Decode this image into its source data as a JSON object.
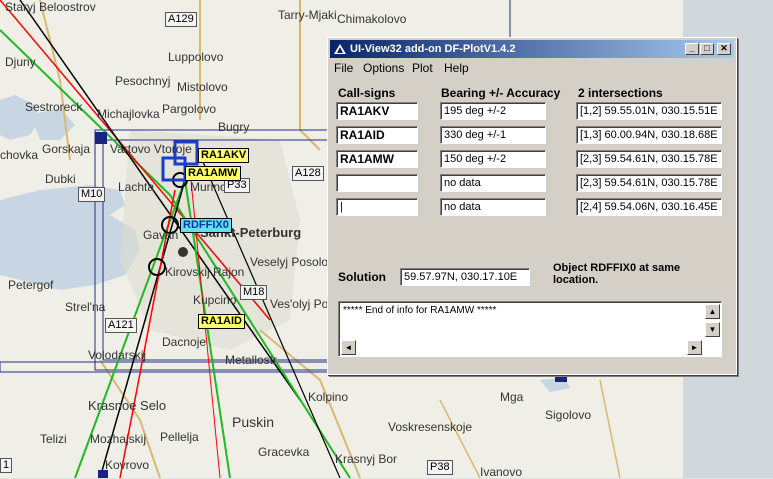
{
  "map": {
    "places": [
      "Staryj Beloostrov",
      "Tarry-Mjaki",
      "Chimakolovo",
      "Djuny",
      "Luppolovo",
      "Sestroreck",
      "Pesochnyj",
      "Mistolovo",
      "Michajlovka",
      "Pargolovo",
      "Bugry",
      "Gorskaja",
      "Vartovo Vtoroje",
      "chovka",
      "Dubki",
      "Lachta",
      "Murino",
      "Petergof",
      "Strel'na",
      "Gavan",
      "Sankt-Peterburg",
      "Kirovskij Rajon",
      "Veselyj Posolok",
      "Ves'olyj Pos",
      "Kupcino",
      "Dacnoje",
      "Volodarskij",
      "Metallostr",
      "Krasnoe Selo",
      "Mozhajskij",
      "Pellelja",
      "Puskin",
      "Kolpino",
      "Mga",
      "Sigolovo",
      "Telizi",
      "Kovrovo",
      "Gracevka",
      "Voskresenskoje",
      "Krasnyj Bor",
      "Ivanovo"
    ],
    "roads": [
      "A129",
      "A128",
      "P33",
      "M10",
      "M18",
      "A121",
      "P38",
      "1"
    ],
    "stations": {
      "s1": "RA1AKV",
      "s2": "RA1AMW",
      "s3": "RDFFIX0",
      "s4": "RA1AID"
    }
  },
  "window": {
    "title": "UI-View32 add-on DF-PlotV1.4.2",
    "menu": [
      "File",
      "Options",
      "Plot",
      "Help"
    ],
    "headers": {
      "callsigns": "Call-signs",
      "bearing": "Bearing +/- Accuracy",
      "intersections": "2 intersections"
    },
    "rows": [
      {
        "call": "RA1AKV",
        "bearing": "195 deg +/-2",
        "inter": "[1,2]  59.55.01N, 030.15.51E"
      },
      {
        "call": "RA1AID",
        "bearing": "330 deg +/-1",
        "inter": "[1,3]  60.00.94N, 030.18.68E"
      },
      {
        "call": "RA1AMW",
        "bearing": "150 deg +/-2",
        "inter": "[2,3]  59.54.61N, 030.15.78E"
      },
      {
        "call": "",
        "bearing": "no data",
        "inter": "[2,3]  59.54.61N, 030.15.78E"
      },
      {
        "call": "|",
        "bearing": "no data",
        "inter": "[2,4]  59.54.06N, 030.16.45E"
      }
    ],
    "solution_label": "Solution",
    "solution_value": "59.57.97N, 030.17.10E",
    "object_note": "Object RDFFIX0 at same location.",
    "memo": "***** End of info for RA1AMW *****"
  }
}
